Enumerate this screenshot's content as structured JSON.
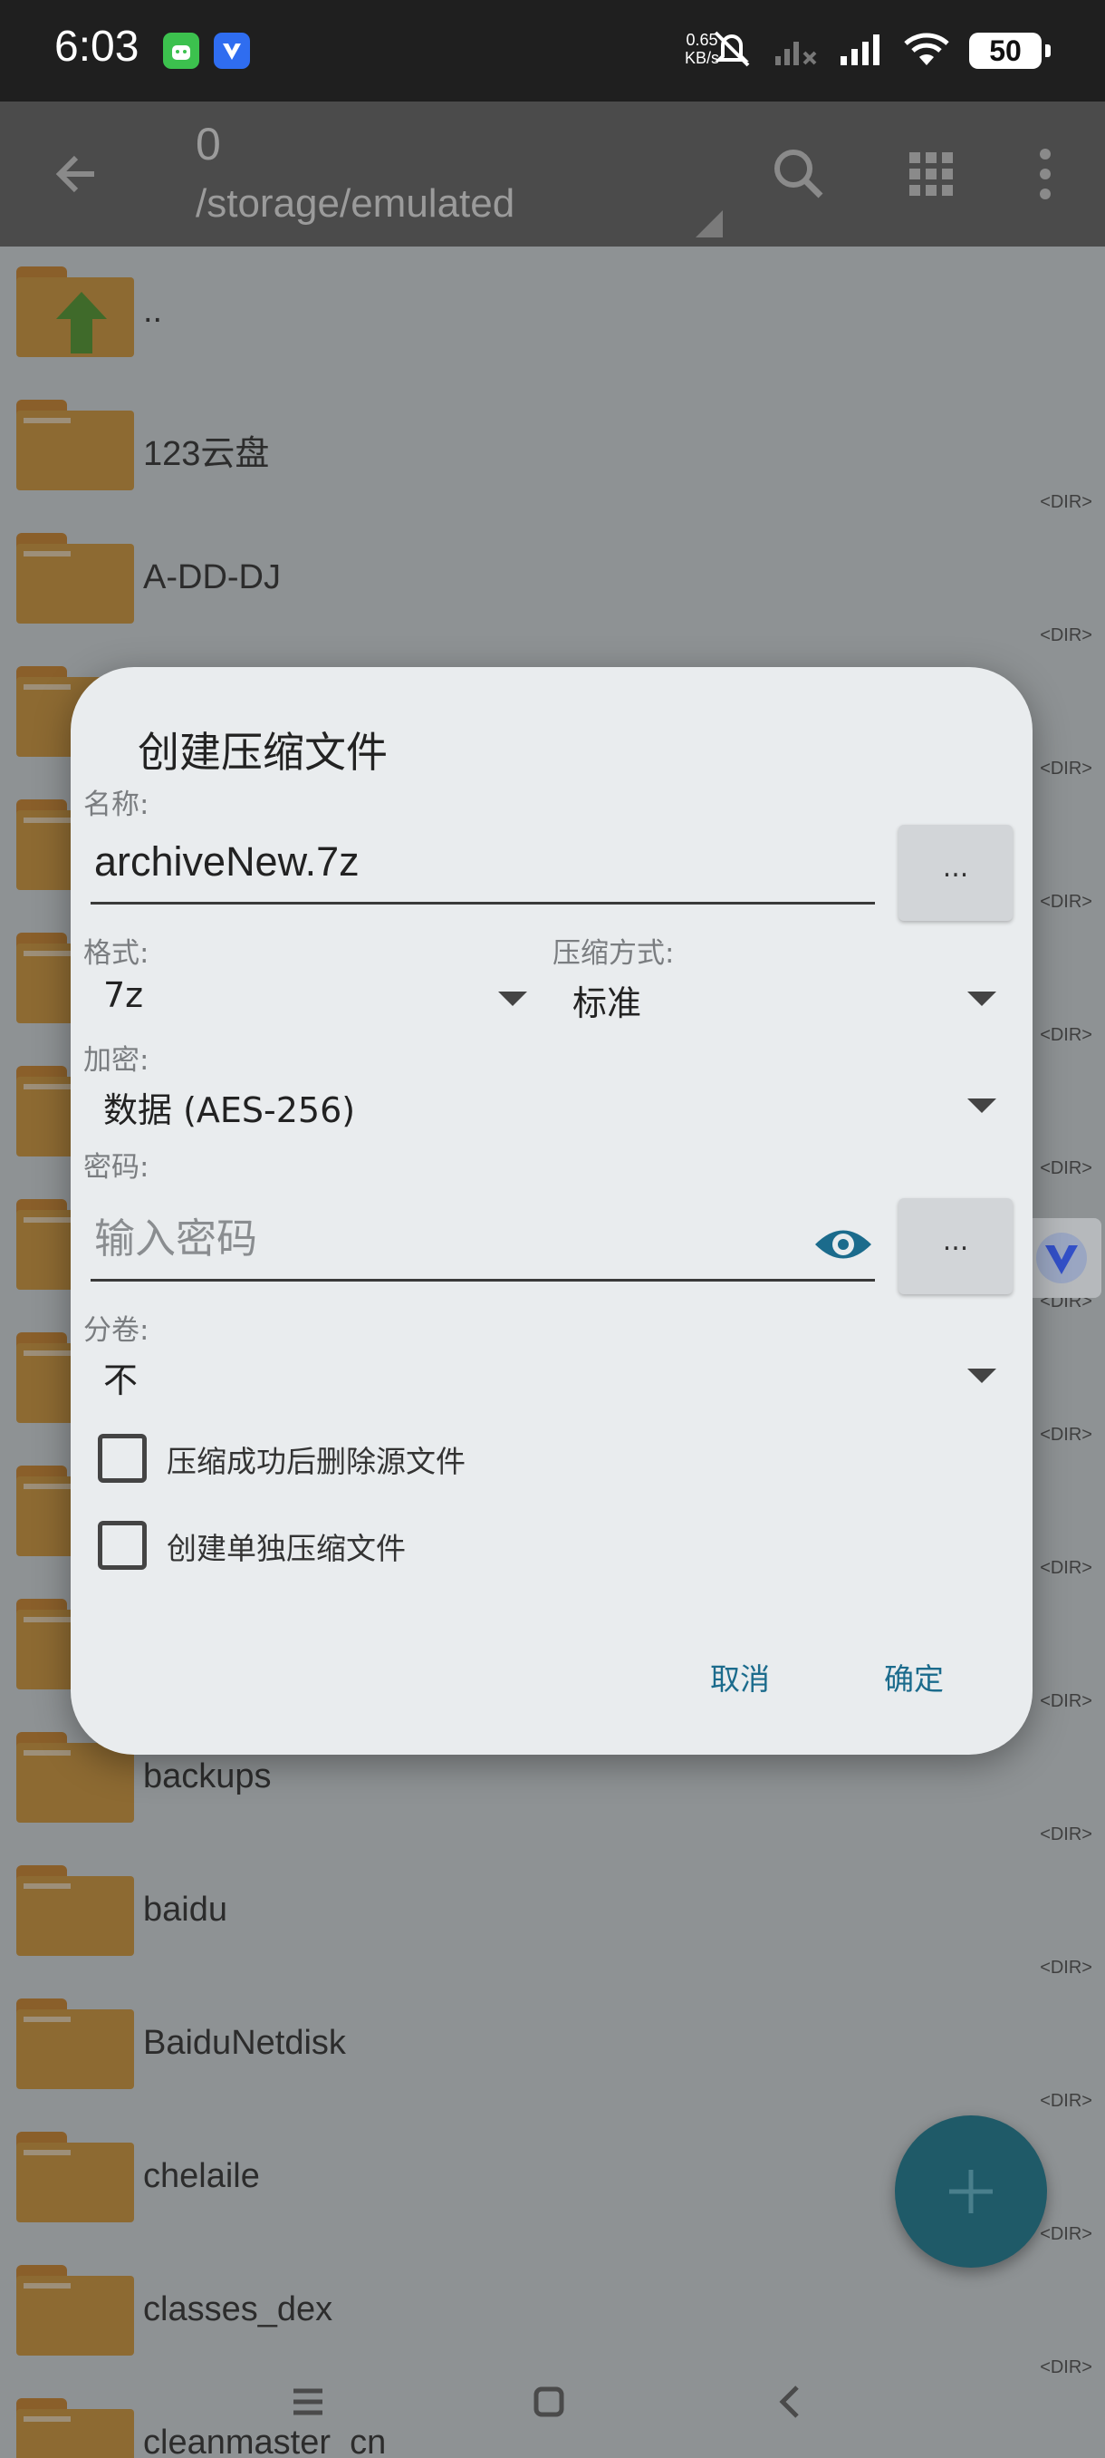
{
  "status_bar": {
    "time": "6:03",
    "net_speed_value": "0.65",
    "net_speed_unit": "KB/s",
    "battery": "50",
    "icons": [
      "mute-icon",
      "signal-icon",
      "signal-icon",
      "wifi-icon",
      "battery-icon"
    ]
  },
  "app_bar": {
    "count": "0",
    "path": "/storage/emulated",
    "icons": [
      "back-arrow-icon",
      "search-icon",
      "grid-icon",
      "more-vert-icon"
    ]
  },
  "files": [
    {
      "name": "..",
      "dir": ""
    },
    {
      "name": "123云盘",
      "dir": "<DIR>"
    },
    {
      "name": "A-DD-DJ",
      "dir": "<DIR>"
    },
    {
      "name": "",
      "dir": "<DIR>"
    },
    {
      "name": "",
      "dir": "<DIR>"
    },
    {
      "name": "",
      "dir": "<DIR>"
    },
    {
      "name": "",
      "dir": "<DIR>"
    },
    {
      "name": "",
      "dir": "<DIR>"
    },
    {
      "name": "",
      "dir": "<DIR>"
    },
    {
      "name": "",
      "dir": "<DIR>"
    },
    {
      "name": "",
      "dir": "<DIR>"
    },
    {
      "name": "backups",
      "dir": "<DIR>"
    },
    {
      "name": "baidu",
      "dir": "<DIR>"
    },
    {
      "name": "BaiduNetdisk",
      "dir": "<DIR>"
    },
    {
      "name": "chelaile",
      "dir": "<DIR>"
    },
    {
      "name": "classes_dex",
      "dir": "<DIR>"
    },
    {
      "name": "cleanmaster_cn",
      "dir": ""
    }
  ],
  "dialog": {
    "title": "创建压缩文件",
    "name_label": "名称:",
    "name_value": "archiveNew.7z",
    "browse_label": "...",
    "format_label": "格式:",
    "format_value": "7z",
    "method_label": "压缩方式:",
    "method_value": "标准",
    "encrypt_label": "加密:",
    "encrypt_value": "数据 (AES-256)",
    "password_label": "密码:",
    "password_placeholder": "输入密码",
    "password_more_label": "...",
    "volume_label": "分卷:",
    "volume_value": "不",
    "delete_source_label": "压缩成功后删除源文件",
    "delete_source_checked": false,
    "separate_label": "创建单独压缩文件",
    "separate_checked": false,
    "cancel": "取消",
    "ok": "确定"
  },
  "colors": {
    "accent": "#1b6b8c",
    "folder": "#8d6a32",
    "appbar": "#4b4b4b",
    "fab": "#1f5a68"
  }
}
